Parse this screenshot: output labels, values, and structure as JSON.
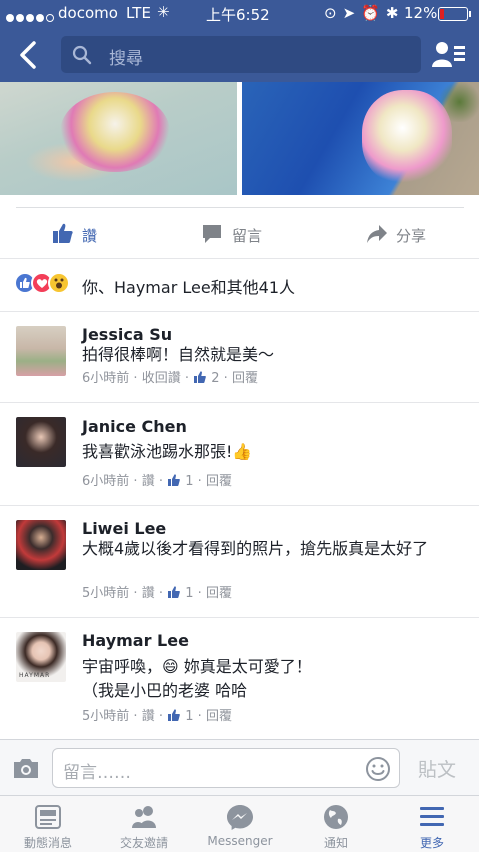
{
  "status_bar": {
    "carrier": "docomo",
    "network": "LTE",
    "time": "上午6:52",
    "battery": "12%",
    "battery_level": 0.12
  },
  "header": {
    "search_placeholder": "搜尋"
  },
  "post_actions": {
    "like": "讚",
    "comment": "留言",
    "share": "分享"
  },
  "reactions": {
    "summary": "你、Haymar Lee和其他41人",
    "types": [
      "like",
      "love",
      "haha"
    ]
  },
  "comments": [
    {
      "name": "Jessica Su",
      "text": "拍得很棒啊！自然就是美～",
      "meta_time": "6小時前",
      "meta_action": "收回讚",
      "likes": "2",
      "reply": "回覆"
    },
    {
      "name": "Janice Chen",
      "text": "我喜歡泳池踢水那張!👍",
      "meta_time": "6小時前",
      "meta_action": "讚",
      "likes": "1",
      "reply": "回覆"
    },
    {
      "name": "Liwei Lee",
      "text": "大概4歲以後才看得到的照片，搶先版真是太好了",
      "meta_time": "5小時前",
      "meta_action": "讚",
      "likes": "1",
      "reply": "回覆"
    },
    {
      "name": "Haymar Lee",
      "text_line1": "宇宙呼喚，😄 妳真是太可愛了！",
      "text_line2": "（我是小巴的老婆 哈哈",
      "meta_time": "5小時前",
      "meta_action": "讚",
      "likes": "1",
      "reply": "回覆",
      "avatar_watermark": "HAYMAR"
    }
  ],
  "comment_input": {
    "placeholder": "留言……",
    "send": "貼文"
  },
  "tab_bar": [
    {
      "label": "動態消息",
      "icon": "news-feed-icon"
    },
    {
      "label": "交友邀請",
      "icon": "friend-requests-icon"
    },
    {
      "label": "Messenger",
      "icon": "messenger-icon"
    },
    {
      "label": "通知",
      "icon": "globe-icon"
    },
    {
      "label": "更多",
      "icon": "menu-icon",
      "active": true
    }
  ],
  "colors": {
    "brand": "#3b5998",
    "link": "#4267b2",
    "meta": "#90949c"
  }
}
